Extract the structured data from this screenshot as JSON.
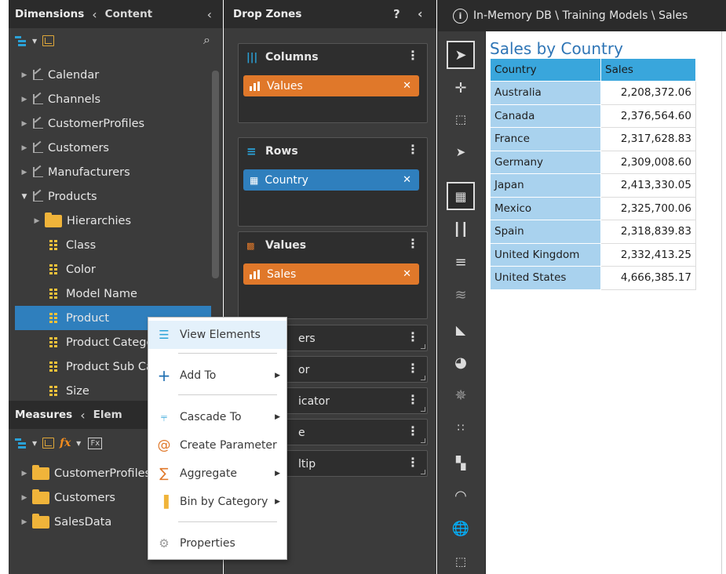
{
  "colors": {
    "panel_bg": "#3b3b3b",
    "header_bg": "#2b2b2b",
    "accent_blue": "#2f7fbd",
    "accent_orange": "#e0782a",
    "table_header": "#39a6dc",
    "table_rowhead": "#a9d2ee",
    "title_blue": "#2e75b6"
  },
  "left_panel": {
    "tabs": {
      "dimensions": "Dimensions",
      "content": "Content"
    },
    "dimensions": [
      {
        "label": "Calendar",
        "icon": "dimension-icon",
        "expanded": false
      },
      {
        "label": "Channels",
        "icon": "dimension-icon",
        "expanded": false
      },
      {
        "label": "CustomerProfiles",
        "icon": "dimension-icon",
        "expanded": false
      },
      {
        "label": "Customers",
        "icon": "dimension-icon",
        "expanded": false
      },
      {
        "label": "Manufacturers",
        "icon": "dimension-icon",
        "expanded": false
      },
      {
        "label": "Products",
        "icon": "dimension-icon",
        "expanded": true
      }
    ],
    "products_children": {
      "hierarchies": "Hierarchies",
      "attributes": [
        "Class",
        "Color",
        "Model Name",
        "Product",
        "Product Catego",
        "Product Sub Ca",
        "Size"
      ]
    },
    "measures_tabs": {
      "measures": "Measures",
      "elements": "Elem"
    },
    "measures": [
      "CustomerProfiles",
      "Customers",
      "SalesData"
    ]
  },
  "drop_zones": {
    "title": "Drop Zones",
    "help": "?",
    "columns": {
      "title": "Columns",
      "chip": "Values"
    },
    "rows": {
      "title": "Rows",
      "chip": "Country"
    },
    "values": {
      "title": "Values",
      "chip": "Sales"
    },
    "small_zones": [
      "ers",
      "or",
      "icator",
      "e",
      "ltip"
    ]
  },
  "breadcrumb": "In-Memory DB \\ Training Models \\ Sales",
  "report": {
    "title": "Sales by Country",
    "columns": [
      "Country",
      "Sales"
    ],
    "rows": [
      {
        "country": "Australia",
        "sales": "2,208,372.06"
      },
      {
        "country": "Canada",
        "sales": "2,376,564.60"
      },
      {
        "country": "France",
        "sales": "2,317,628.83"
      },
      {
        "country": "Germany",
        "sales": "2,309,008.60"
      },
      {
        "country": "Japan",
        "sales": "2,413,330.05"
      },
      {
        "country": "Mexico",
        "sales": "2,325,700.06"
      },
      {
        "country": "Spain",
        "sales": "2,318,839.83"
      },
      {
        "country": "United Kingdom",
        "sales": "2,332,413.25"
      },
      {
        "country": "United States",
        "sales": "4,666,385.17"
      }
    ]
  },
  "context_menu": {
    "items": [
      {
        "label": "View Elements",
        "icon": "view-elements-icon",
        "submenu": false,
        "highlighted": true
      },
      {
        "label": "Add To",
        "icon": "plus-icon",
        "submenu": true
      },
      {
        "label": "Cascade To",
        "icon": "cascade-icon",
        "submenu": true
      },
      {
        "label": "Create Parameter",
        "icon": "at-icon",
        "submenu": false
      },
      {
        "label": "Aggregate",
        "icon": "sigma-icon",
        "submenu": true
      },
      {
        "label": "Bin by Category",
        "icon": "bin-icon",
        "submenu": true
      },
      {
        "label": "Properties",
        "icon": "gear-icon",
        "submenu": false
      }
    ]
  }
}
